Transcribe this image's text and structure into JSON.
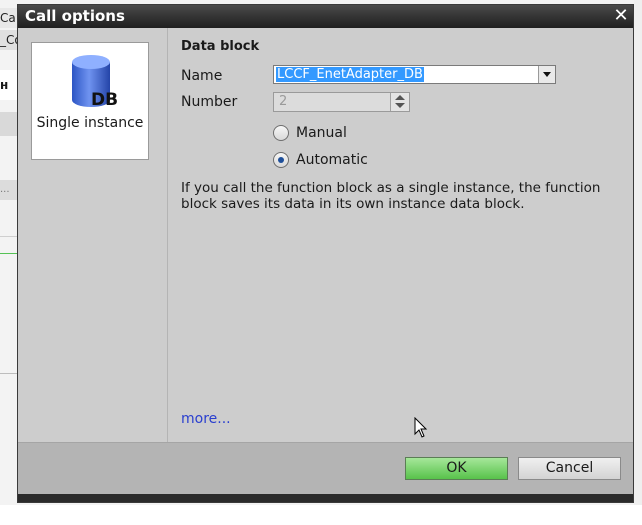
{
  "background": {
    "tab1": "Ca",
    "tab2": "_Co",
    "heading": "н",
    "dots": "..."
  },
  "dialog": {
    "title": "Call options",
    "close_glyph": "✕",
    "instance": {
      "icon": "database-cylinder-icon",
      "icon_text": "DB",
      "label": "Single instance"
    },
    "section_title": "Data block",
    "name_label": "Name",
    "name_value": "LCCF_EnetAdapter_DB",
    "number_label": "Number",
    "number_value": "2",
    "radio_manual_label": "Manual",
    "radio_auto_label": "Automatic",
    "selected_radio": "Automatic",
    "description": "If you call the function block as a single instance, the function block saves its data in its own instance data block.",
    "more_link": "more...",
    "ok_label": "OK",
    "cancel_label": "Cancel"
  },
  "colors": {
    "title_bar": "#2b2b2b",
    "selection": "#3399ff",
    "ok_button": "#6fcf62",
    "db_icon": "#3a6dd8"
  }
}
